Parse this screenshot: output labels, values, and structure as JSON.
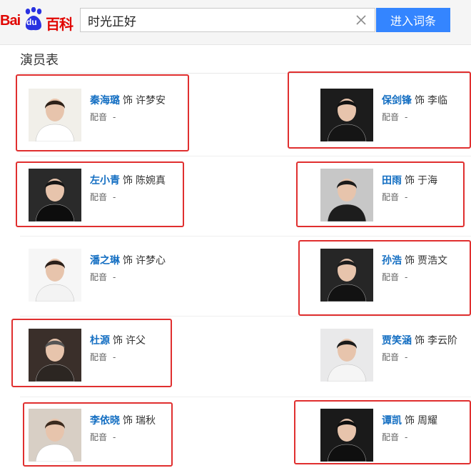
{
  "header": {
    "logo_bai": "Bai",
    "logo_du": "du",
    "logo_baike": "百科",
    "search_value": "时光正好",
    "enter_label": "进入词条"
  },
  "section": {
    "title": "演员表"
  },
  "cast": [
    {
      "actor": "秦海璐",
      "verb": "饰",
      "role": "许梦安",
      "dub_label": "配音",
      "dub_value": "-",
      "photo_bg": "#f1efe9",
      "outfit": "#ffffff",
      "hair": "#2c2018"
    },
    {
      "actor": "保剑锋",
      "verb": "饰",
      "role": "李临",
      "dub_label": "配音",
      "dub_value": "-",
      "photo_bg": "#1c1c1c",
      "outfit": "#151515",
      "hair": "#111111"
    },
    {
      "actor": "左小青",
      "verb": "饰",
      "role": "陈婉真",
      "dub_label": "配音",
      "dub_value": "-",
      "photo_bg": "#2a2a2a",
      "outfit": "#0d0d0d",
      "hair": "#151515"
    },
    {
      "actor": "田雨",
      "verb": "饰",
      "role": "于海",
      "dub_label": "配音",
      "dub_value": "-",
      "photo_bg": "#c7c7c7",
      "outfit": "#1d1d1d",
      "hair": "#1a1a1a"
    },
    {
      "actor": "潘之琳",
      "verb": "饰",
      "role": "许梦心",
      "dub_label": "配音",
      "dub_value": "-",
      "photo_bg": "#f6f6f6",
      "outfit": "#f3f3f3",
      "hair": "#2a1f1a"
    },
    {
      "actor": "孙浩",
      "verb": "饰",
      "role": "贾浩文",
      "dub_label": "配音",
      "dub_value": "-",
      "photo_bg": "#262626",
      "outfit": "#121212",
      "hair": "#1c1c1c"
    },
    {
      "actor": "杜源",
      "verb": "饰",
      "role": "许父",
      "dub_label": "配音",
      "dub_value": "-",
      "photo_bg": "#3a2f2a",
      "outfit": "#2c2622",
      "hair": "#555555"
    },
    {
      "actor": "贾笑涵",
      "verb": "饰",
      "role": "李云阶",
      "dub_label": "配音",
      "dub_value": "-",
      "photo_bg": "#e9e9ea",
      "outfit": "#f5f5f5",
      "hair": "#1a1a1a"
    },
    {
      "actor": "李依晓",
      "verb": "饰",
      "role": "瑞秋",
      "dub_label": "配音",
      "dub_value": "-",
      "photo_bg": "#d8cfc5",
      "outfit": "#ffffff",
      "hair": "#3a2a1e"
    },
    {
      "actor": "谭凯",
      "verb": "饰",
      "role": "周耀",
      "dub_label": "配音",
      "dub_value": "-",
      "photo_bg": "#1a1a1a",
      "outfit": "#0f0f0f",
      "hair": "#0e0e0e"
    }
  ],
  "colors": {
    "accent": "#3485ff",
    "name_link": "#136ec2",
    "highlight": "#e02f2f",
    "brand_red": "#e10602"
  }
}
